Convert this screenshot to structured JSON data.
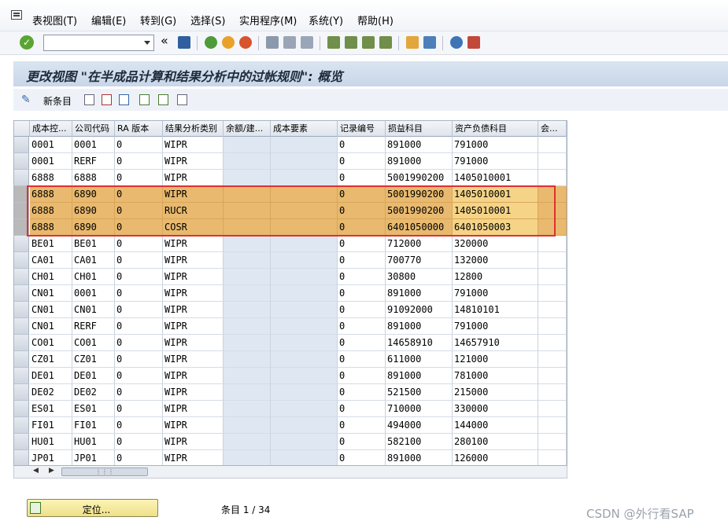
{
  "menu": [
    "表视图(T)",
    "编辑(E)",
    "转到(G)",
    "选择(S)",
    "实用程序(M)",
    "系统(Y)",
    "帮助(H)"
  ],
  "title": "更改视图 \"在半成品计算和结果分析中的过帐规则\": 概览",
  "app_toolbar": {
    "new_entries_label": "新条目"
  },
  "table": {
    "columns": [
      "成本控...",
      "公司代码",
      "RA 版本",
      "结果分析类别",
      "余额/建...",
      "成本要素",
      "记录编号",
      "损益科目",
      "资产负债科目",
      "会..."
    ],
    "rows": [
      {
        "cells": [
          "0001",
          "0001",
          "0",
          "WIPR",
          "",
          "",
          "0",
          "891000",
          "791000",
          ""
        ],
        "highlighted": false
      },
      {
        "cells": [
          "0001",
          "RERF",
          "0",
          "WIPR",
          "",
          "",
          "0",
          "891000",
          "791000",
          ""
        ],
        "highlighted": false
      },
      {
        "cells": [
          "6888",
          "6888",
          "0",
          "WIPR",
          "",
          "",
          "0",
          "5001990200",
          "1405010001",
          ""
        ],
        "highlighted": false
      },
      {
        "cells": [
          "6888",
          "6890",
          "0",
          "WIPR",
          "",
          "",
          "0",
          "5001990200",
          "1405010001",
          ""
        ],
        "highlighted": true
      },
      {
        "cells": [
          "6888",
          "6890",
          "0",
          "RUCR",
          "",
          "",
          "0",
          "5001990200",
          "1405010001",
          ""
        ],
        "highlighted": true
      },
      {
        "cells": [
          "6888",
          "6890",
          "0",
          "COSR",
          "",
          "",
          "0",
          "6401050000",
          "6401050003",
          ""
        ],
        "highlighted": true
      },
      {
        "cells": [
          "BE01",
          "BE01",
          "0",
          "WIPR",
          "",
          "",
          "0",
          "712000",
          "320000",
          ""
        ],
        "highlighted": false
      },
      {
        "cells": [
          "CA01",
          "CA01",
          "0",
          "WIPR",
          "",
          "",
          "0",
          "700770",
          "132000",
          ""
        ],
        "highlighted": false
      },
      {
        "cells": [
          "CH01",
          "CH01",
          "0",
          "WIPR",
          "",
          "",
          "0",
          "30800",
          "12800",
          ""
        ],
        "highlighted": false
      },
      {
        "cells": [
          "CN01",
          "0001",
          "0",
          "WIPR",
          "",
          "",
          "0",
          "891000",
          "791000",
          ""
        ],
        "highlighted": false
      },
      {
        "cells": [
          "CN01",
          "CN01",
          "0",
          "WIPR",
          "",
          "",
          "0",
          "91092000",
          "14810101",
          ""
        ],
        "highlighted": false
      },
      {
        "cells": [
          "CN01",
          "RERF",
          "0",
          "WIPR",
          "",
          "",
          "0",
          "891000",
          "791000",
          ""
        ],
        "highlighted": false
      },
      {
        "cells": [
          "CO01",
          "CO01",
          "0",
          "WIPR",
          "",
          "",
          "0",
          "14658910",
          "14657910",
          ""
        ],
        "highlighted": false
      },
      {
        "cells": [
          "CZ01",
          "CZ01",
          "0",
          "WIPR",
          "",
          "",
          "0",
          "611000",
          "121000",
          ""
        ],
        "highlighted": false
      },
      {
        "cells": [
          "DE01",
          "DE01",
          "0",
          "WIPR",
          "",
          "",
          "0",
          "891000",
          "781000",
          ""
        ],
        "highlighted": false
      },
      {
        "cells": [
          "DE02",
          "DE02",
          "0",
          "WIPR",
          "",
          "",
          "0",
          "521500",
          "215000",
          ""
        ],
        "highlighted": false
      },
      {
        "cells": [
          "ES01",
          "ES01",
          "0",
          "WIPR",
          "",
          "",
          "0",
          "710000",
          "330000",
          ""
        ],
        "highlighted": false
      },
      {
        "cells": [
          "FI01",
          "FI01",
          "0",
          "WIPR",
          "",
          "",
          "0",
          "494000",
          "144000",
          ""
        ],
        "highlighted": false
      },
      {
        "cells": [
          "HU01",
          "HU01",
          "0",
          "WIPR",
          "",
          "",
          "0",
          "582100",
          "280100",
          ""
        ],
        "highlighted": false
      },
      {
        "cells": [
          "JP01",
          "JP01",
          "0",
          "WIPR",
          "",
          "",
          "0",
          "891000",
          "126000",
          ""
        ],
        "highlighted": false
      }
    ]
  },
  "position_button_label": "定位...",
  "entry_count": "条目 1 / 34",
  "watermark": "CSDN @外行看SAP"
}
